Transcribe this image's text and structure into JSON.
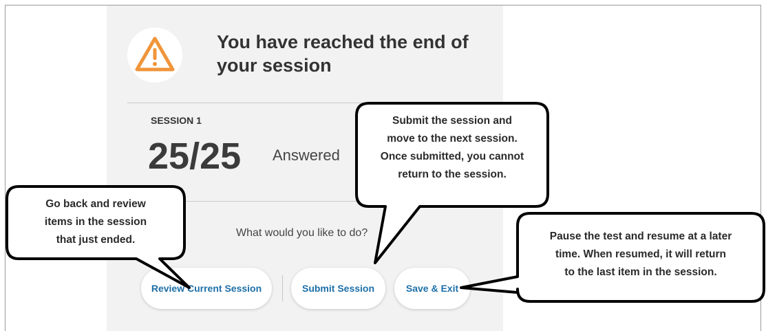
{
  "dialog": {
    "title": "You have reached the end of your session",
    "session_label": "SESSION 1",
    "score": "25/25",
    "score_status": "Answered",
    "question": "What would you like to do?",
    "icon": "warning-triangle-icon",
    "accent_color": "#f0953a",
    "link_color": "#1c6fa8"
  },
  "buttons": {
    "review": "Review Current Session",
    "submit": "Submit Session",
    "save_exit": "Save & Exit"
  },
  "callouts": {
    "review": [
      "Go back and review",
      "items in the session",
      "that just ended."
    ],
    "submit": [
      "Submit the session and",
      "move to the next session.",
      "Once submitted, you cannot",
      "return to the session."
    ],
    "save_exit": [
      "Pause the test and resume at a later",
      "time.  When resumed, it will return",
      "to the last item in the session."
    ]
  }
}
